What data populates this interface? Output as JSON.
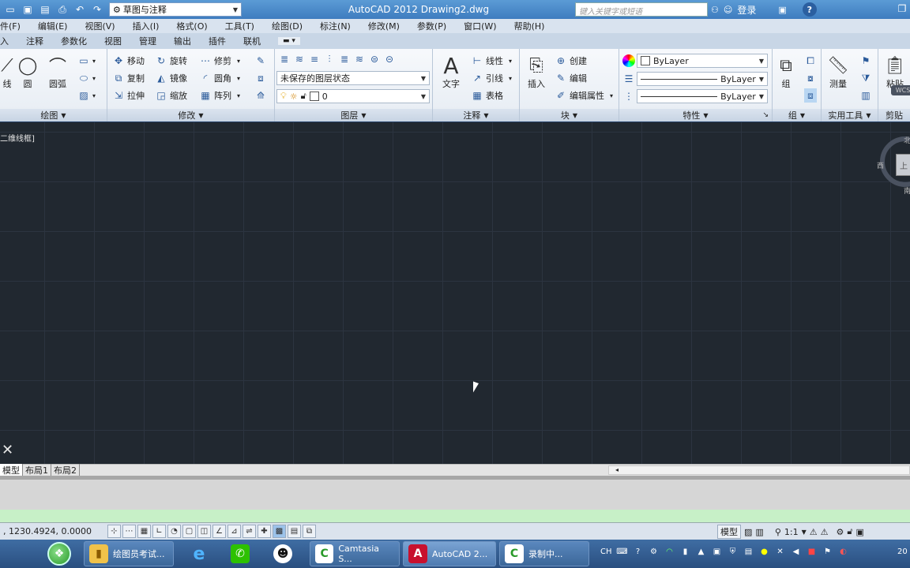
{
  "titlebar": {
    "workspace": "草图与注释",
    "title": "AutoCAD 2012    Drawing2.dwg",
    "search_placeholder": "键入关键字或短语",
    "login": "登录"
  },
  "menu": [
    "件(F)",
    "编辑(E)",
    "视图(V)",
    "插入(I)",
    "格式(O)",
    "工具(T)",
    "绘图(D)",
    "标注(N)",
    "修改(M)",
    "参数(P)",
    "窗口(W)",
    "帮助(H)"
  ],
  "ribbon_tabs": [
    "入",
    "注释",
    "参数化",
    "视图",
    "管理",
    "输出",
    "插件",
    "联机"
  ],
  "ribbon": {
    "draw": {
      "line": "线",
      "circle": "圆",
      "arc": "圆弧",
      "footer": "绘图"
    },
    "modify": {
      "move": "移动",
      "rotate": "旋转",
      "trim": "修剪",
      "copy": "复制",
      "mirror": "镜像",
      "fillet": "圆角",
      "stretch": "拉伸",
      "scale": "缩放",
      "array": "阵列",
      "footer": "修改"
    },
    "layer": {
      "state": "未保存的图层状态",
      "current": "0",
      "footer": "图层"
    },
    "annotation": {
      "text": "文字",
      "linear": "线性",
      "leader": "引线",
      "table": "表格",
      "footer": "注释"
    },
    "block": {
      "insert": "插入",
      "create": "创建",
      "edit": "编辑",
      "edit_attr": "编辑属性",
      "footer": "块"
    },
    "properties": {
      "color": "ByLayer",
      "lineweight": "ByLayer",
      "linetype": "ByLayer",
      "footer": "特性"
    },
    "groups": {
      "group": "组",
      "footer": "组"
    },
    "utilities": {
      "measure": "测量",
      "footer": "实用工具"
    },
    "clipboard": {
      "paste": "粘贴",
      "footer": "剪贴"
    }
  },
  "viewport": {
    "label": "二维线框]",
    "viewcube": {
      "north": "北",
      "west": "西",
      "south": "南",
      "face": "上",
      "wcs": "WCS"
    }
  },
  "layout_tabs": [
    "模型",
    "布局1",
    "布局2"
  ],
  "status": {
    "coords": ", 1230.4924, 0.0000",
    "model": "模型",
    "scale": "1:1"
  },
  "taskbar": {
    "items": [
      {
        "label": "绘图员考试..."
      },
      {
        "label": "Camtasia S..."
      },
      {
        "label": "AutoCAD 2..."
      },
      {
        "label": "录制中..."
      }
    ],
    "ime": "CH",
    "clock": "20"
  },
  "colors": {
    "canvas": "#212830",
    "grid": "#2c3440",
    "titlebar": "#3e7cbf",
    "taskbar": "#2a4f80"
  }
}
